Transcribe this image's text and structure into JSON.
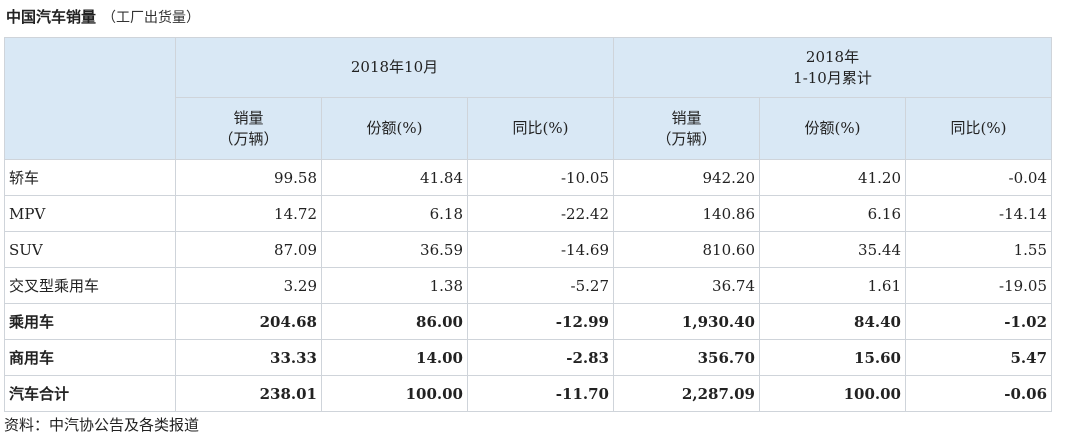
{
  "title": "中国汽车销量",
  "subtitle": "（工厂出货量）",
  "header": {
    "group1": "2018年10月",
    "group2_line1": "2018年",
    "group2_line2": "1-10月累计",
    "col_sales_line1": "销量",
    "col_sales_line2": "（万辆）",
    "col_share": "份额(%)",
    "col_yoy": "同比(%)"
  },
  "rows": [
    {
      "label": "轿车",
      "bold": false,
      "values": [
        "99.58",
        "41.84",
        "-10.05",
        "942.20",
        "41.20",
        "-0.04"
      ]
    },
    {
      "label": "MPV",
      "bold": false,
      "values": [
        "14.72",
        "6.18",
        "-22.42",
        "140.86",
        "6.16",
        "-14.14"
      ]
    },
    {
      "label": "SUV",
      "bold": false,
      "values": [
        "87.09",
        "36.59",
        "-14.69",
        "810.60",
        "35.44",
        "1.55"
      ]
    },
    {
      "label": "交叉型乘用车",
      "bold": false,
      "values": [
        "3.29",
        "1.38",
        "-5.27",
        "36.74",
        "1.61",
        "-19.05"
      ]
    },
    {
      "label": "乘用车",
      "bold": true,
      "values": [
        "204.68",
        "86.00",
        "-12.99",
        "1,930.40",
        "84.40",
        "-1.02"
      ]
    },
    {
      "label": "商用车",
      "bold": true,
      "values": [
        "33.33",
        "14.00",
        "-2.83",
        "356.70",
        "15.60",
        "5.47"
      ]
    },
    {
      "label": "汽车合计",
      "bold": true,
      "values": [
        "238.01",
        "100.00",
        "-11.70",
        "2,287.09",
        "100.00",
        "-0.06"
      ]
    }
  ],
  "footer": "资料：中汽协公告及各类报道",
  "colors": {
    "header_bg": "#d9e8f5",
    "border": "#cfd4da"
  }
}
